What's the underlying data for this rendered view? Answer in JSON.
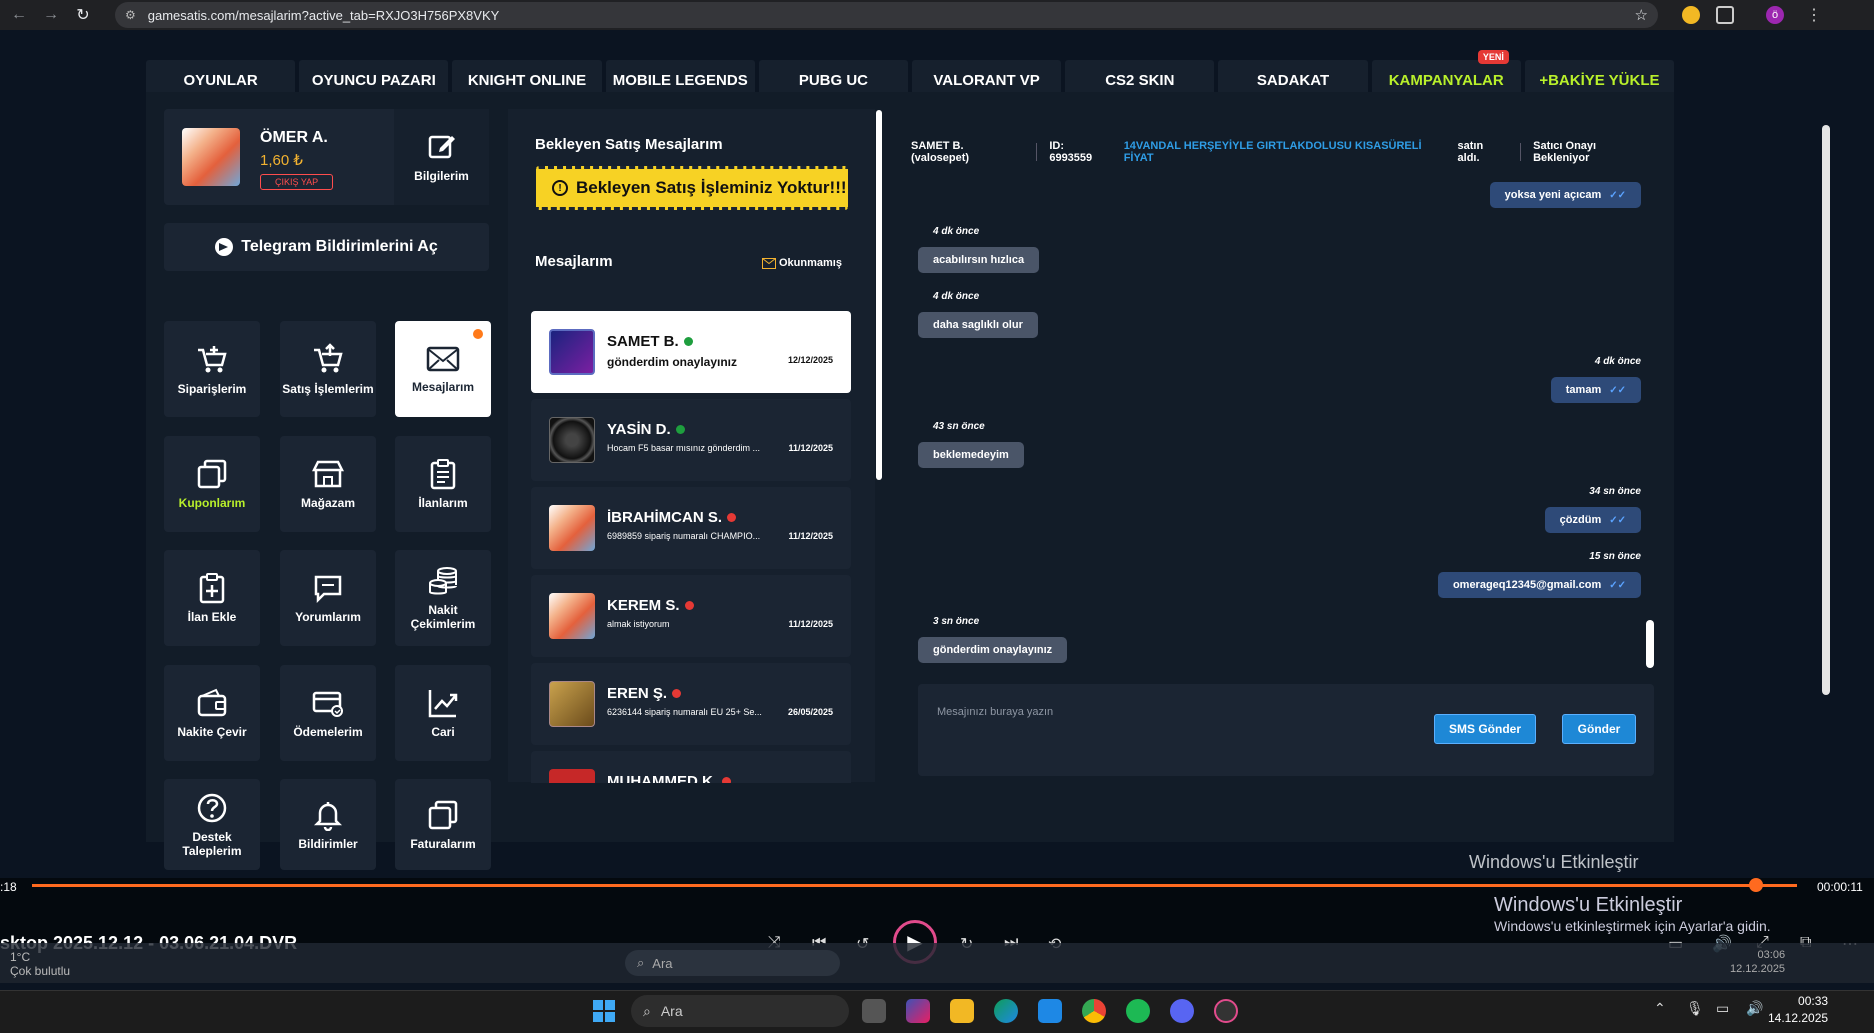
{
  "browser": {
    "url": "gamesatis.com/mesajlarim?active_tab=RXJO3H756PX8VKY",
    "profile_initial": "ö"
  },
  "topnav": {
    "items": [
      "OYUNLAR",
      "OYUNCU PAZARI",
      "KNIGHT ONLINE",
      "MOBILE LEGENDS",
      "PUBG UC",
      "VALORANT VP",
      "CS2 SKIN",
      "SADAKAT",
      "KAMPANYALAR",
      "+BAKİYE YÜKLE"
    ],
    "new_badge": "YENİ"
  },
  "profile": {
    "name": "ÖMER A.",
    "balance": "1,60 ₺",
    "logout": "ÇIKIŞ YAP",
    "info_label": "Bilgilerim"
  },
  "telegram_label": "Telegram Bildirimlerini Aç",
  "tiles": [
    "Siparişlerim",
    "Satış İşlemlerim",
    "Mesajlarım",
    "Kuponlarım",
    "Mağazam",
    "İlanlarım",
    "İlan Ekle",
    "Yorumlarım",
    "Nakit Çekimlerim",
    "Nakite Çevir",
    "Ödemelerim",
    "Cari",
    "Destek Taleplerim",
    "Bildirimler",
    "Faturalarım"
  ],
  "pending": {
    "title": "Bekleyen Satış Mesajlarım",
    "notice": "Bekleyen Satış İşleminiz Yoktur!!!"
  },
  "messages": {
    "title": "Mesajlarım",
    "unread_label": "Okunmamış",
    "items": [
      {
        "name": "SAMET B.",
        "preview": "gönderdim onaylayınız",
        "date": "12/12/2025",
        "status": "green"
      },
      {
        "name": "YASİN D.",
        "preview": "Hocam F5 basar mısınız gönderdim ...",
        "date": "11/12/2025",
        "status": "green"
      },
      {
        "name": "İBRAHİMCAN S.",
        "preview": "6989859 sipariş numaralı CHAMPIO...",
        "date": "11/12/2025",
        "status": "red"
      },
      {
        "name": "KEREM S.",
        "preview": "almak istiyorum",
        "date": "11/12/2025",
        "status": "red"
      },
      {
        "name": "EREN Ş.",
        "preview": "6236144 sipariş numaralı EU 25+ Se...",
        "date": "26/05/2025",
        "status": "red"
      },
      {
        "name": "MUHAMMED K.",
        "preview": "",
        "date": "",
        "status": "red"
      }
    ]
  },
  "chat": {
    "user": "SAMET B. (valosepet)",
    "order_id": "ID: 6993559",
    "product": "14VANDAL HERŞEYİYLE GIRTLAKDOLUSU KISASÜRELİ FİYAT",
    "product_suffix": "satın aldı.",
    "status": "Satıcı Onayı Bekleniyor",
    "msgs": [
      {
        "dir": "out",
        "text": "yoksa yeni açıcam",
        "time": ""
      },
      {
        "dir": "in",
        "text": "acabılırsın hızlıca",
        "time": "4 dk önce"
      },
      {
        "dir": "in",
        "text": "daha saglıklı olur",
        "time": "4 dk önce"
      },
      {
        "dir": "out",
        "text": "tamam",
        "time": "4 dk önce"
      },
      {
        "dir": "in",
        "text": "beklemedeyim",
        "time": "43 sn önce"
      },
      {
        "dir": "out",
        "text": "çözdüm",
        "time": "34 sn önce"
      },
      {
        "dir": "out",
        "text": "omerageq12345@gmail.com",
        "time": "15 sn önce"
      },
      {
        "dir": "in",
        "text": "gönderdim onaylayınız",
        "time": "3 sn önce"
      }
    ],
    "input_placeholder": "Mesajınızı buraya yazın",
    "sms_button": "SMS Gönder",
    "send_button": "Gönder"
  },
  "windows_activate": "Windows'u Etkinleştir",
  "windows_activate_sub": "Windows'u etkinleştirmek için Ayarlar'a gidin.",
  "player": {
    "time_elapsed": ":18",
    "time_total": "00:00:11",
    "filename": "sktop 2025.12.12 - 03.06.21.04.DVR",
    "progress": 0.985
  },
  "inner_taskbar": {
    "weather_temp": "1°C",
    "weather_desc": "Çok bulutlu",
    "search": "Ara",
    "time": "03:06",
    "date": "12.12.2025"
  },
  "taskbar": {
    "search": "Ara",
    "time": "00:33",
    "date": "14.12.2025"
  }
}
